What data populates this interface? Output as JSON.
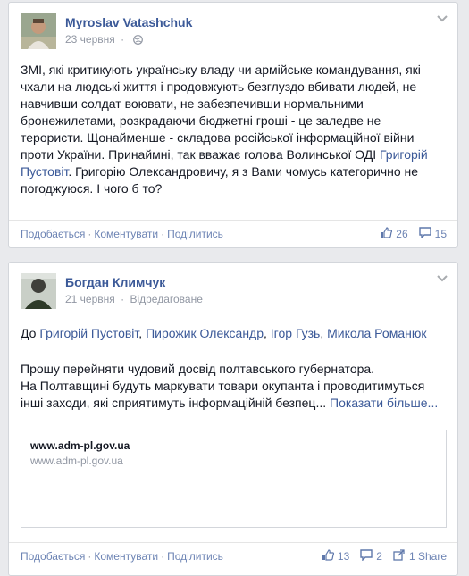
{
  "post1": {
    "author": "Myroslav Vatashchuk",
    "date": "23 червня",
    "body_parts": {
      "p1": "ЗМІ, які критикують українську владу чи армійське командування, які чхали на людські життя і продовжують безглуздо вбивати людей, не навчивши солдат воювати, не забезпечивши нормальними бронежилетами, розкрадаючи бюджетні гроші - це заледве не терористи. Щонайменше - складова російської інформаційної війни проти України. Принаймні, так вважає голова Волинської ОДІ ",
      "link": "Григорій Пустовіт",
      "p2": ". Григорію Олександровичу, я з Вами чомусь категорично не погоджуюся. І чого б то?"
    },
    "actions": {
      "like": "Подобається",
      "comment": "Коментувати",
      "share": "Поділитись"
    },
    "likes": "26",
    "comments": "15"
  },
  "post2": {
    "author": "Богдан Климчук",
    "date": "21 червня",
    "edited": "Відредаговане",
    "tags_prefix": "До ",
    "tags": [
      "Григорій Пустовіт",
      "Пирожик Олександр",
      "Ігор Гузь",
      "Микола Романюк"
    ],
    "body": "Прошу перейняти чудовий досвід полтавського губернатора.\nНа Полтавщині будуть маркувати товари окупанта і проводитимуться інші заходи, які сприятимуть інформаційній безпец... ",
    "show_more": "Показати більше...",
    "preview": {
      "title": "www.adm-pl.gov.ua",
      "subtitle": "www.adm-pl.gov.ua"
    },
    "actions": {
      "like": "Подобається",
      "comment": "Коментувати",
      "share": "Поділитись"
    },
    "likes": "13",
    "comments": "2",
    "shares": "1 Share"
  },
  "colors": {
    "link": "#3b5998",
    "action": "#6d84b4",
    "meta": "#9197a3",
    "background": "#e9eaed"
  }
}
